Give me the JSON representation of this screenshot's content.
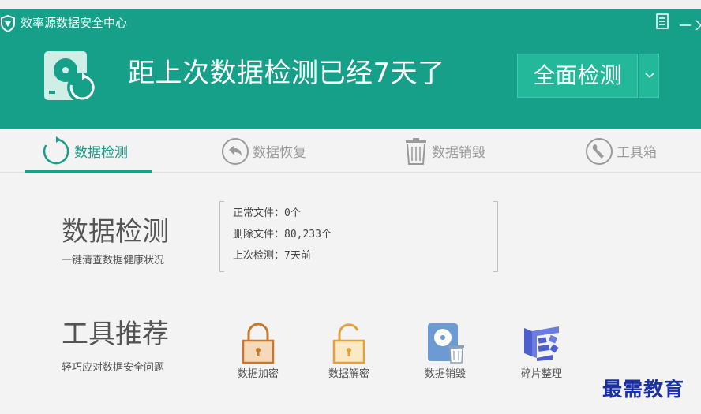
{
  "window": {
    "title": "效率源数据安全中心"
  },
  "header": {
    "headline": "距上次数据检测已经7天了",
    "scan_button": "全面检测"
  },
  "tabs": [
    {
      "label": "数据检测",
      "icon": "refresh-icon",
      "active": true
    },
    {
      "label": "数据恢复",
      "icon": "back-arrow-icon",
      "active": false
    },
    {
      "label": "数据销毁",
      "icon": "trash-icon",
      "active": false
    },
    {
      "label": "工具箱",
      "icon": "wrench-icon",
      "active": false
    }
  ],
  "detect_section": {
    "title": "数据检测",
    "subtitle": "一键清查数据健康状况",
    "stats": [
      "正常文件：0个",
      "删除文件：80,233个",
      "上次检测：7天前"
    ]
  },
  "tools_section": {
    "title": "工具推荐",
    "subtitle": "轻巧应对数据安全问题",
    "tools": [
      {
        "label": "数据加密",
        "icon": "lock-closed-icon"
      },
      {
        "label": "数据解密",
        "icon": "lock-open-icon"
      },
      {
        "label": "数据销毁",
        "icon": "disk-trash-icon"
      },
      {
        "label": "碎片整理",
        "icon": "defrag-icon"
      }
    ]
  },
  "watermark": "最需教育",
  "colors": {
    "brand": "#16a08a",
    "button": "#23b89a",
    "background": "#f3f3f3",
    "watermark": "#1a2fa8",
    "lock_closed": "#c9782a",
    "lock_open": "#e2a23a",
    "defrag": "#4d5fd0"
  }
}
